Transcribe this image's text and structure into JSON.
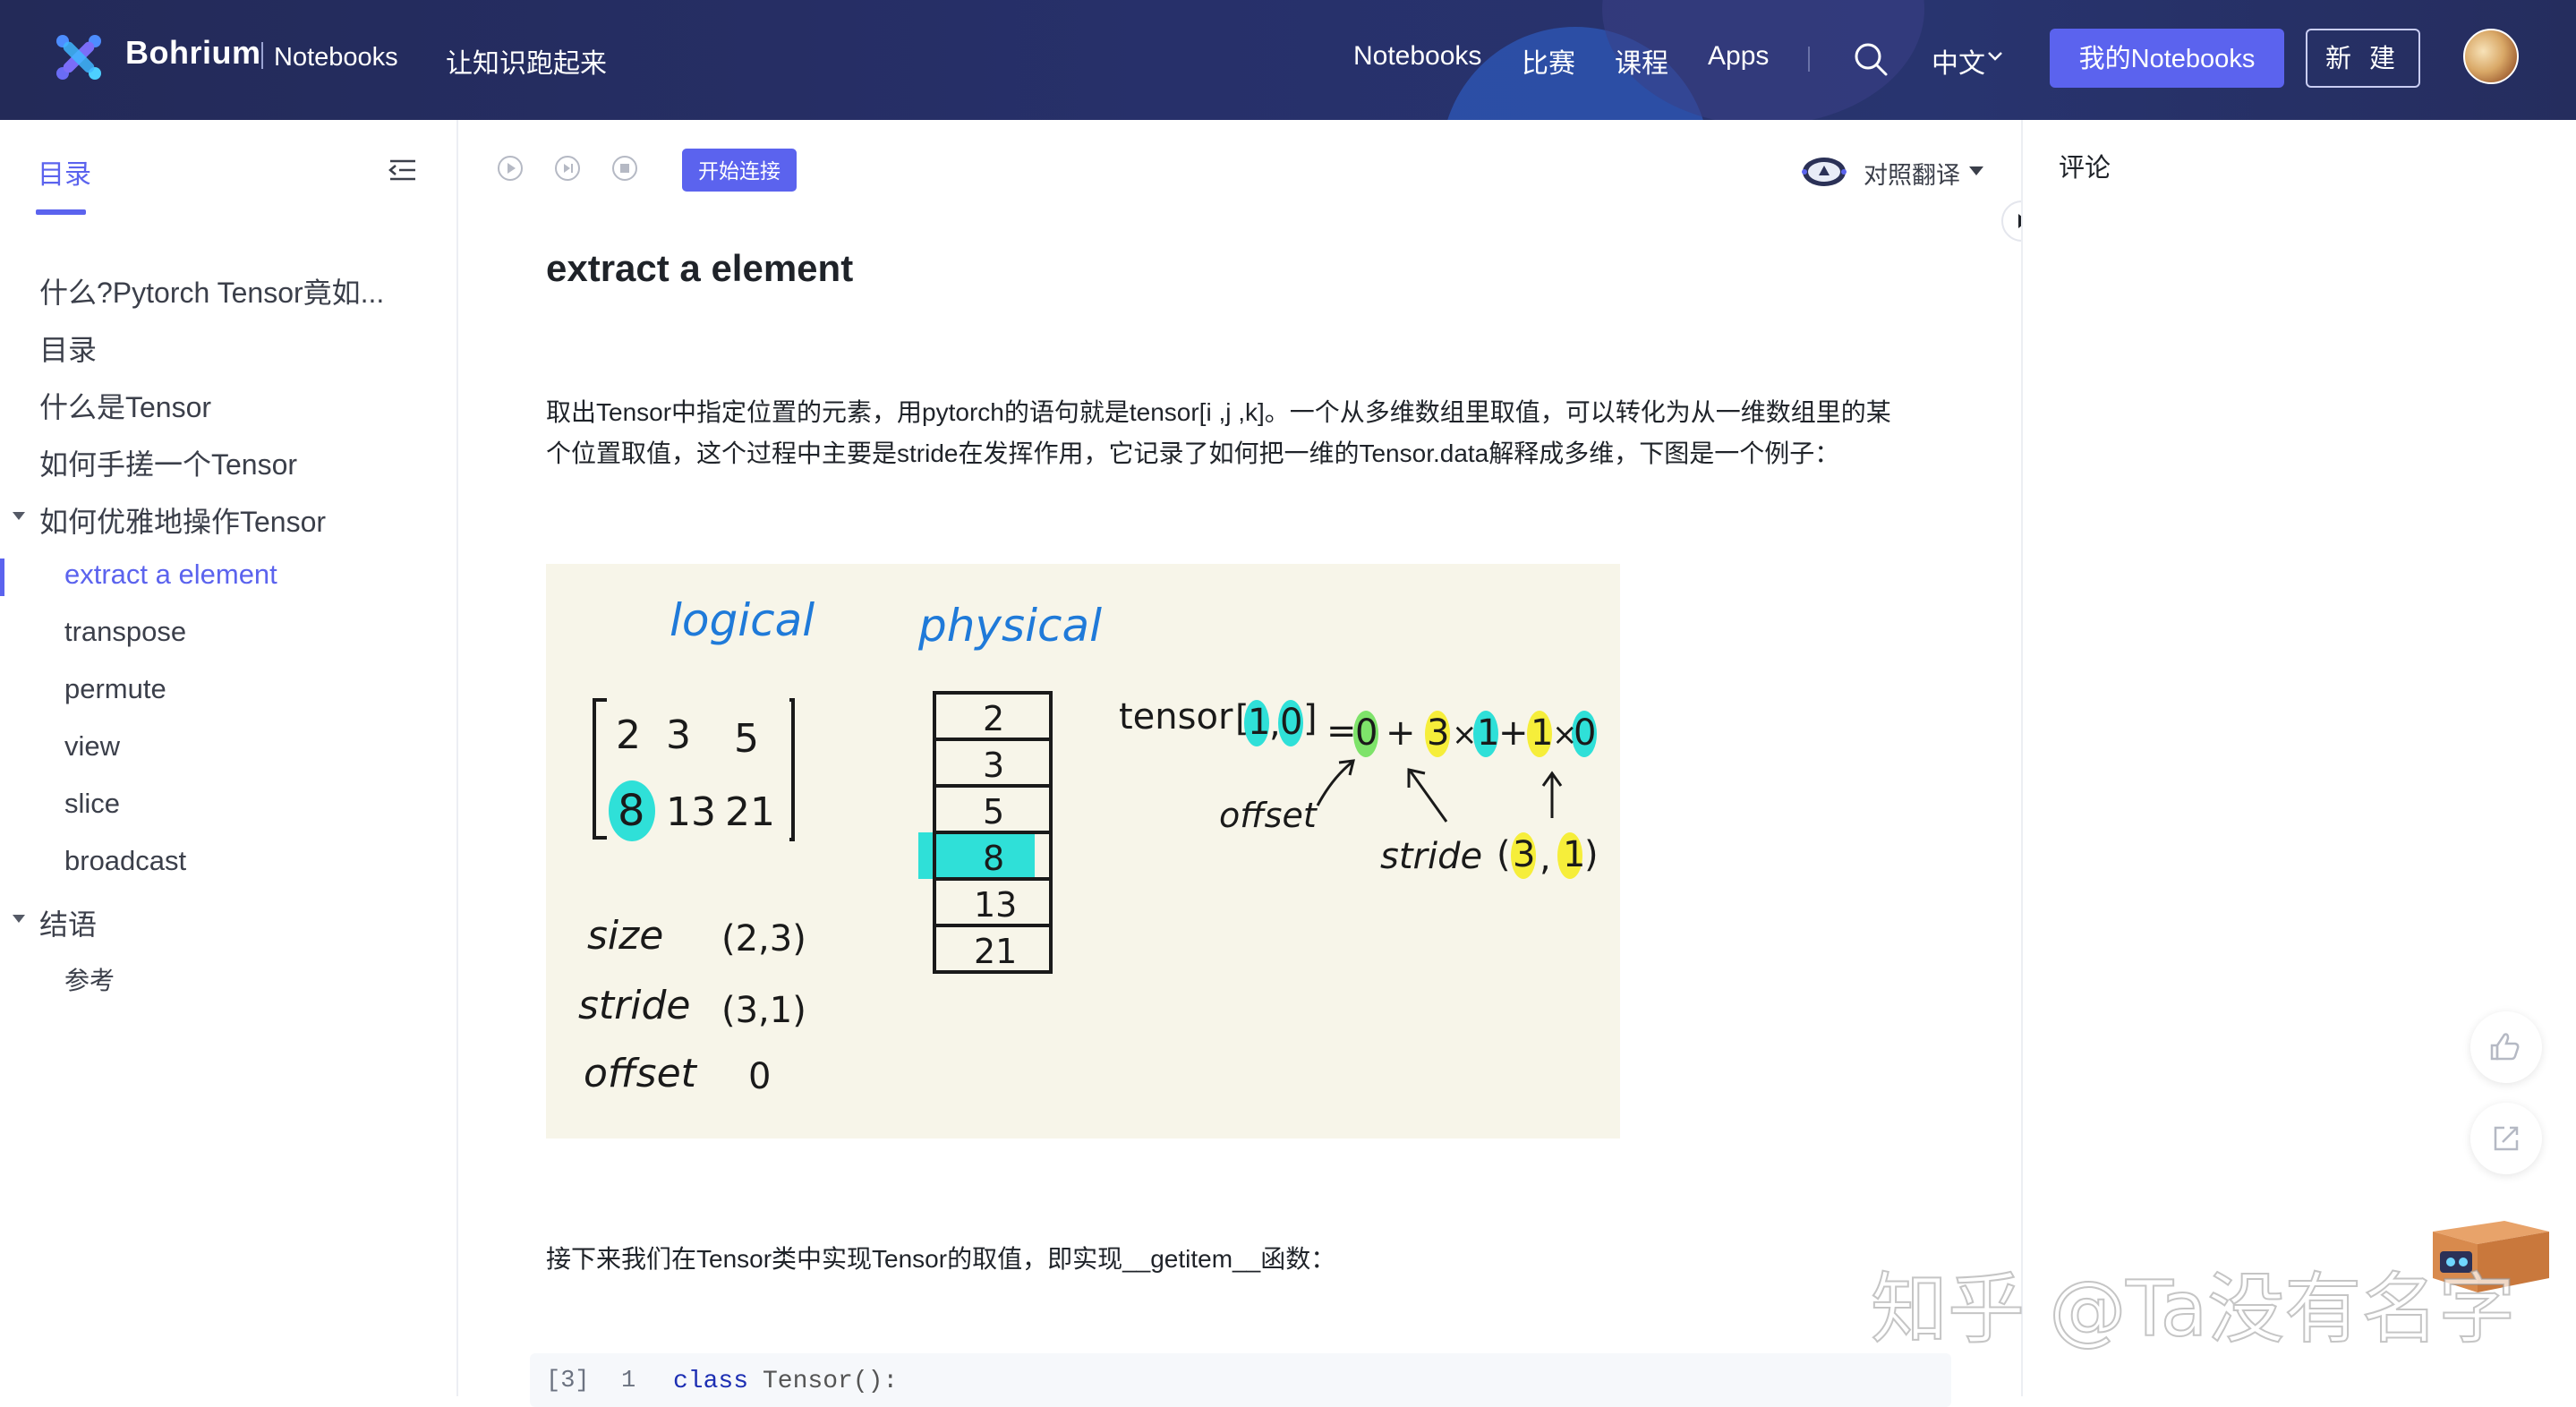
{
  "header": {
    "brand": "Bohrium",
    "brand_sub": "Notebooks",
    "tagline": "让知识跑起来",
    "nav": [
      "Notebooks",
      "比赛",
      "课程",
      "Apps"
    ],
    "language": "中文",
    "my_notebooks_label": "我的Notebooks",
    "new_label": "新 建",
    "icons": [
      "bohrium-logo-icon",
      "search-icon",
      "chevron-down-icon",
      "avatar"
    ]
  },
  "sidebar": {
    "tab_label": "目录",
    "items": [
      {
        "label": "什么?Pytorch Tensor竟如...",
        "level": 1
      },
      {
        "label": "目录",
        "level": 1
      },
      {
        "label": "什么是Tensor",
        "level": 1
      },
      {
        "label": "如何手搓一个Tensor",
        "level": 1
      },
      {
        "label": "如何优雅地操作Tensor",
        "level": 1,
        "expanded": true
      },
      {
        "label": "extract a element",
        "level": 2,
        "active": true
      },
      {
        "label": "transpose",
        "level": 2
      },
      {
        "label": "permute",
        "level": 2
      },
      {
        "label": "view",
        "level": 2
      },
      {
        "label": "slice",
        "level": 2
      },
      {
        "label": "broadcast",
        "level": 2
      },
      {
        "label": "结语",
        "level": 1,
        "expanded": true
      },
      {
        "label": "参考",
        "level": 3
      }
    ]
  },
  "toolbar": {
    "connect_label": "开始连接",
    "translate_label": "对照翻译",
    "icons": [
      "run-icon",
      "restart-icon",
      "stop-icon",
      "translate-robot-icon"
    ]
  },
  "article": {
    "title": "extract a element",
    "para1_line1": "取出Tensor中指定位置的元素，用pytorch的语句就是tensor[i ,j ,k]。一个从多维数组里取值，可以转化为从一维数组里的某",
    "para1_line2": "个位置取值，这个过程中主要是stride在发挥作用，它记录了如何把一维的Tensor.data解释成多维，下图是一个例子：",
    "para2": "接下来我们在Tensor类中实现Tensor的取值，即实现__getitem__函数："
  },
  "figure": {
    "logical_label": "logical",
    "physical_label": "physical",
    "matrix_row1": [
      "2",
      "3",
      "5"
    ],
    "matrix_row2": [
      "8",
      "13",
      "21"
    ],
    "physical_cells": [
      "2",
      "3",
      "5",
      "8",
      "13",
      "21"
    ],
    "size_label": "size",
    "size_value": "(2,3)",
    "stride_label": "stride",
    "stride_value": "(3,1)",
    "offset_label": "offset",
    "offset_value": "0",
    "formula": [
      "tensor",
      "[",
      "1",
      ",",
      "0",
      "]",
      "=",
      "0",
      "+",
      "3",
      "×",
      "1",
      "+",
      "1",
      "×",
      "0"
    ],
    "formula_offset_label": "offset",
    "formula_stride_label": "stride",
    "formula_stride_values": [
      "3",
      "1"
    ],
    "highlight_cyan": "#2fe0d8",
    "highlight_yellow": "#f6ee3a",
    "highlight_green": "#7ee36a",
    "ink_blue": "#1f7ad9"
  },
  "code": {
    "cell_index": "[3]",
    "line_number": "1",
    "keyword": "class",
    "rest": "Tensor():"
  },
  "right_panel": {
    "comments_label": "评论",
    "icons": [
      "thumbs-up-icon",
      "share-icon",
      "mascot-box-icon"
    ]
  },
  "watermark": "知乎 @Ta没有名字",
  "colors": {
    "accent": "#5b63ee",
    "header_bg": "#252c60",
    "text": "#1f2329"
  }
}
